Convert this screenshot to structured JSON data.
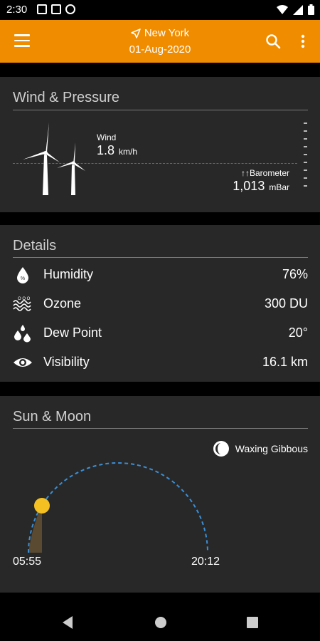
{
  "status": {
    "time": "2:30"
  },
  "appbar": {
    "location": "New York",
    "date": "01-Aug-2020",
    "menu_icon": "hamburger-menu-icon",
    "search_icon": "search-icon",
    "more_icon": "more-vert-icon",
    "accent": "#f08c00"
  },
  "wind_pressure": {
    "title": "Wind & Pressure",
    "wind_label": "Wind",
    "wind_value": "1.8",
    "wind_unit": "km/h",
    "baro_label": "Barometer",
    "baro_arrows": "↑↑",
    "baro_value": "1,013",
    "baro_unit": "mBar"
  },
  "details": {
    "title": "Details",
    "rows": [
      {
        "icon": "humidity-drop-icon",
        "label": "Humidity",
        "value": "76%"
      },
      {
        "icon": "ozone-waves-icon",
        "label": "Ozone",
        "value": "300 DU"
      },
      {
        "icon": "dew-drops-icon",
        "label": "Dew Point",
        "value": "20°"
      },
      {
        "icon": "eye-icon",
        "label": "Visibility",
        "value": "16.1 km"
      }
    ]
  },
  "sun_moon": {
    "title": "Sun & Moon",
    "moon_phase": "Waxing Gibbous",
    "sunrise": "05:55",
    "sunset": "20:12",
    "sun_color": "#f5c022",
    "arc_color": "#3b8fd6"
  }
}
